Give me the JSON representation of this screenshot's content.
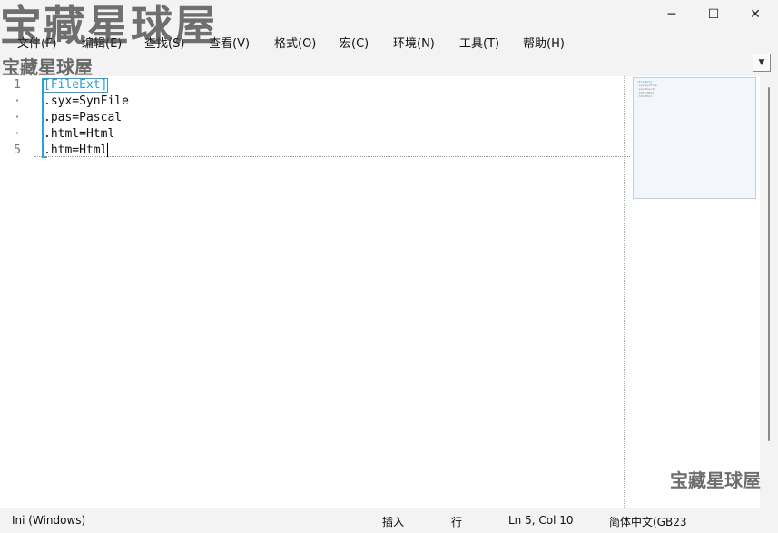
{
  "window": {
    "minimize_glyph": "─",
    "maximize_glyph": "☐",
    "close_glyph": "✕"
  },
  "menu": {
    "items": [
      {
        "label": "文件(F)"
      },
      {
        "label": "编辑(E)"
      },
      {
        "label": "查找(S)"
      },
      {
        "label": "查看(V)"
      },
      {
        "label": "格式(O)"
      },
      {
        "label": "宏(C)"
      },
      {
        "label": "环境(N)"
      },
      {
        "label": "工具(T)"
      },
      {
        "label": "帮助(H)"
      }
    ]
  },
  "toolbar": {
    "dropdown_glyph": "▼"
  },
  "editor": {
    "line_numbers": [
      "1",
      "·",
      "·",
      "·",
      "5"
    ],
    "lines": [
      "[FileExt]",
      ".syx=SynFile",
      ".pas=Pascal",
      ".html=Html",
      ".htm=Html"
    ],
    "accent_color": "#29a0d6"
  },
  "statusbar": {
    "file_type": "Ini (Windows)",
    "insert_mode": "插入",
    "line_mode": "行",
    "position": "Ln 5, Col 10",
    "encoding": "简体中文(GB23"
  },
  "watermark": {
    "text": "宝藏星球屋"
  }
}
